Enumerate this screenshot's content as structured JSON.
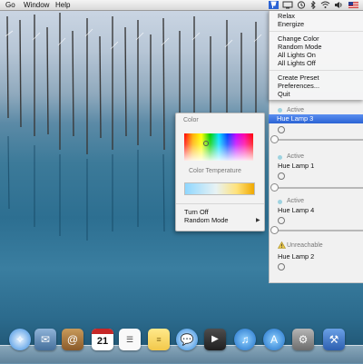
{
  "menubar": {
    "items": [
      {
        "label": "Go"
      },
      {
        "label": "Window"
      },
      {
        "label": "Help"
      }
    ],
    "status_icons": [
      "hue-icon",
      "display-icon",
      "time-machine-icon",
      "bluetooth-icon",
      "wifi-icon",
      "volume-icon",
      "flag-icon"
    ]
  },
  "hue_menu": {
    "items": [
      {
        "label": "Relax"
      },
      {
        "label": "Energize"
      },
      {
        "label": "Change Color"
      },
      {
        "label": "Random Mode"
      },
      {
        "label": "All Lights On"
      },
      {
        "label": "All Lights Off"
      },
      {
        "label": "Create Preset"
      },
      {
        "label": "Preferences..."
      },
      {
        "label": "Quit"
      }
    ]
  },
  "lamps": [
    {
      "status": "Active",
      "name": "Hue Lamp 3",
      "selected": true,
      "brightness": 0.0
    },
    {
      "status": "Active",
      "name": "Hue Lamp 1",
      "selected": false,
      "brightness": 0.0
    },
    {
      "status": "Active",
      "name": "Hue Lamp 4",
      "selected": false,
      "brightness": 0.0
    },
    {
      "status": "Unreachable",
      "name": "Hue Lamp 2",
      "selected": false
    }
  ],
  "color_popover": {
    "color_label": "Color",
    "temperature_label": "Color Temperature",
    "turn_off_label": "Turn Off",
    "random_mode_label": "Random Mode",
    "submenu_arrow": "▶"
  },
  "dock": {
    "icons": [
      "safari-icon",
      "mail-icon",
      "contacts-icon",
      "calendar-icon",
      "reminders-icon",
      "notes-icon",
      "messages-icon",
      "facetime-icon",
      "itunes-icon",
      "app-store-icon",
      "system-preferences-icon",
      "xcode-icon"
    ],
    "calendar_day": "21"
  },
  "colors": {
    "selection": "#2b63d4",
    "active_dot": "#9fd3e0",
    "unreachable": "#e8c64a"
  }
}
